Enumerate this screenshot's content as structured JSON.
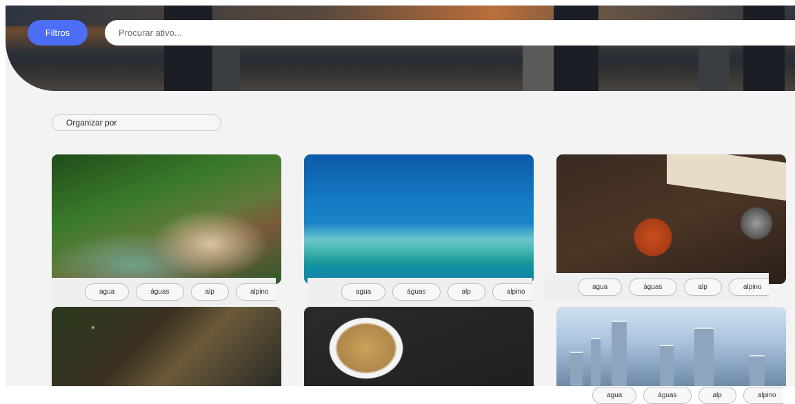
{
  "header": {
    "filter_label": "Filtros",
    "search_placeholder": "Procurar ativo..."
  },
  "sort": {
    "label": "Organizar por"
  },
  "cards": [
    {
      "image": "aerial coastline",
      "tags": [
        "agua",
        "águas",
        "alp",
        "alpino"
      ]
    },
    {
      "image": "surfer on wave",
      "tags": [
        "agua",
        "águas",
        "alp",
        "alpino"
      ]
    },
    {
      "image": "coffee mug and camera",
      "tags": [
        "agua",
        "águas",
        "alp",
        "alpino"
      ]
    },
    {
      "image": "night city aerial",
      "tags": []
    },
    {
      "image": "heart bowl snacks",
      "tags": []
    },
    {
      "image": "futuristic city",
      "tags": [
        "agua",
        "águas",
        "alp",
        "alpino"
      ]
    }
  ],
  "colors": {
    "accent": "#4c6ef5",
    "background": "#f3f3f3"
  }
}
